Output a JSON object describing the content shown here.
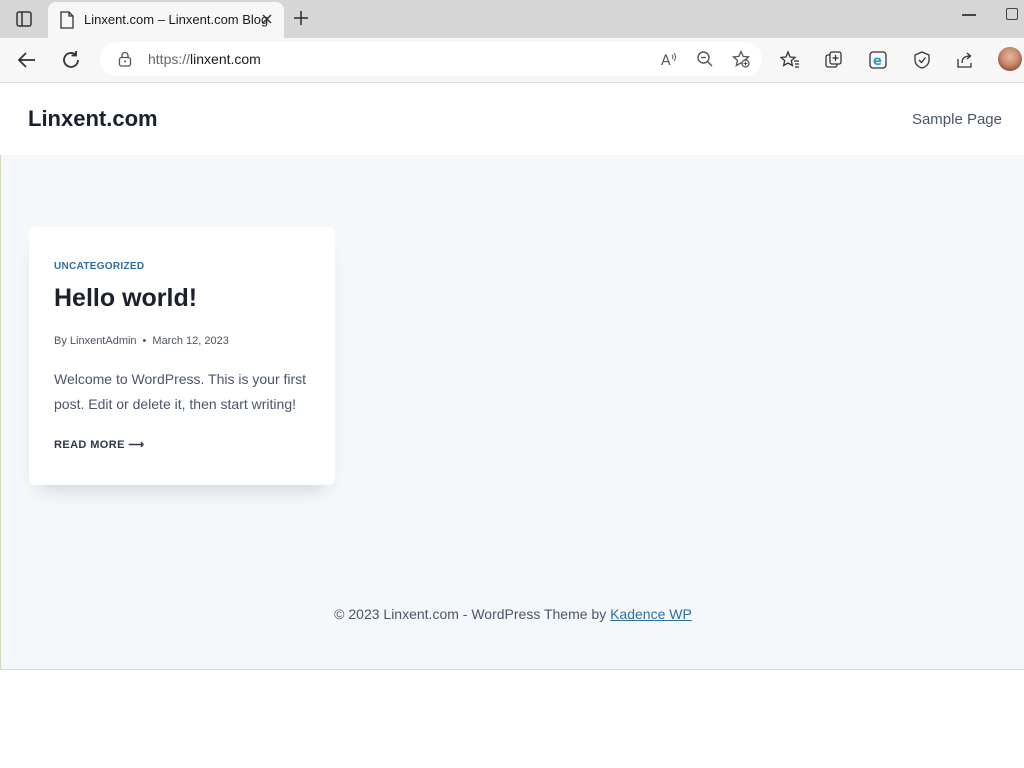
{
  "browser": {
    "tab_title": "Linxent.com – Linxent.com Blog",
    "url_prefix": "https://",
    "url_domain": "linxent.com",
    "icons": [
      "tab-actions-icon",
      "page-icon",
      "close-icon",
      "plus-icon",
      "back-icon",
      "refresh-icon",
      "lock-icon",
      "read-aloud-icon",
      "zoom-icon",
      "add-favorite-icon",
      "favorites-icon",
      "collections-icon",
      "edge-icon",
      "browser-essentials-icon",
      "share-icon"
    ]
  },
  "site": {
    "title": "Linxent.com",
    "nav_link": "Sample Page"
  },
  "post": {
    "category": "UNCATEGORIZED",
    "title": "Hello world!",
    "author": "By LinxentAdmin",
    "separator": "•",
    "date": "March 12, 2023",
    "excerpt": "Welcome to WordPress. This is your first post. Edit or delete it, then start writing!",
    "read_more": "READ MORE",
    "read_more_arrow": "⟶"
  },
  "footer": {
    "text": "© 2023 Linxent.com - WordPress Theme by ",
    "link": "Kadence WP"
  },
  "colors": {
    "accent": "#2d6fa3",
    "content_bg": "#f4f8fa"
  }
}
